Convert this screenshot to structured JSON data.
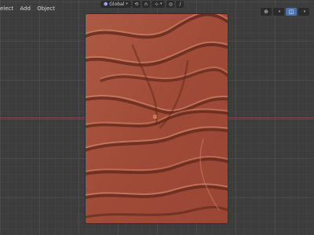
{
  "header": {
    "menu": {
      "select": "elect",
      "add": "Add",
      "object": "Object"
    },
    "transform_orientation": "Global",
    "snap_increment": "⊹",
    "proportional": "/"
  },
  "colors": {
    "viewport_bg": "#3d3d3d",
    "relief_base": "#a24e3a",
    "relief_highlight": "#d78a6c",
    "relief_shadow": "#5a2518",
    "x_axis": "#9a4b4b",
    "active_button": "#4772b3"
  },
  "icons": {
    "global": "global-orientation-icon",
    "pivot": "pivot-icon",
    "snap": "magnet-icon",
    "proportional": "proportional-edit-icon",
    "gizmo": "gizmo-icon",
    "overlays": "overlays-icon",
    "origin": "object-origin-icon"
  }
}
